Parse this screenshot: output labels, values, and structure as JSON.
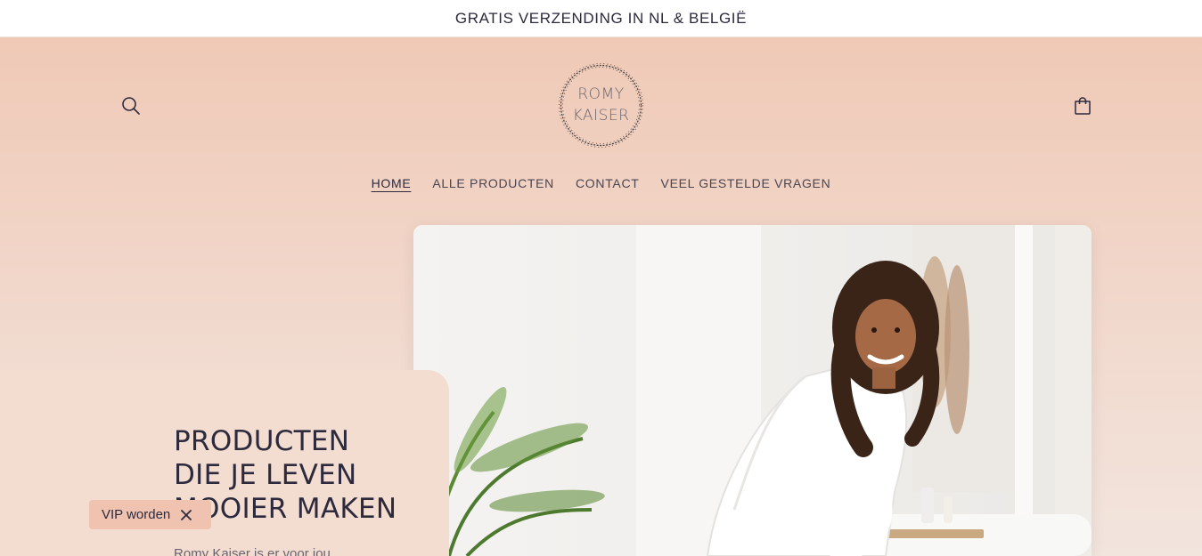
{
  "announcement": {
    "text": "GRATIS VERZENDING IN NL & BELGIË"
  },
  "header": {
    "logo_line1": "ROMY",
    "logo_line2": "KAISER",
    "search_icon": "search-icon",
    "cart_icon": "shopping-bag-icon"
  },
  "nav": {
    "items": [
      {
        "label": "HOME",
        "active": true
      },
      {
        "label": "ALLE PRODUCTEN",
        "active": false
      },
      {
        "label": "CONTACT",
        "active": false
      },
      {
        "label": "VEEL GESTELDE VRAGEN",
        "active": false
      }
    ]
  },
  "hero": {
    "title_line1": "PRODUCTEN",
    "title_line2": "DIE JE LEVEN",
    "title_line3": "MOOIER MAKEN",
    "text": "Romy Kaiser is er voor jou"
  },
  "vip": {
    "label": "VIP worden",
    "close_icon": "close-icon"
  },
  "colors": {
    "header_bg_top": "#f0c9b6",
    "header_bg_bottom": "#f2e5de",
    "vip_bg": "#efc3b0",
    "text": "#2d2a3d"
  }
}
